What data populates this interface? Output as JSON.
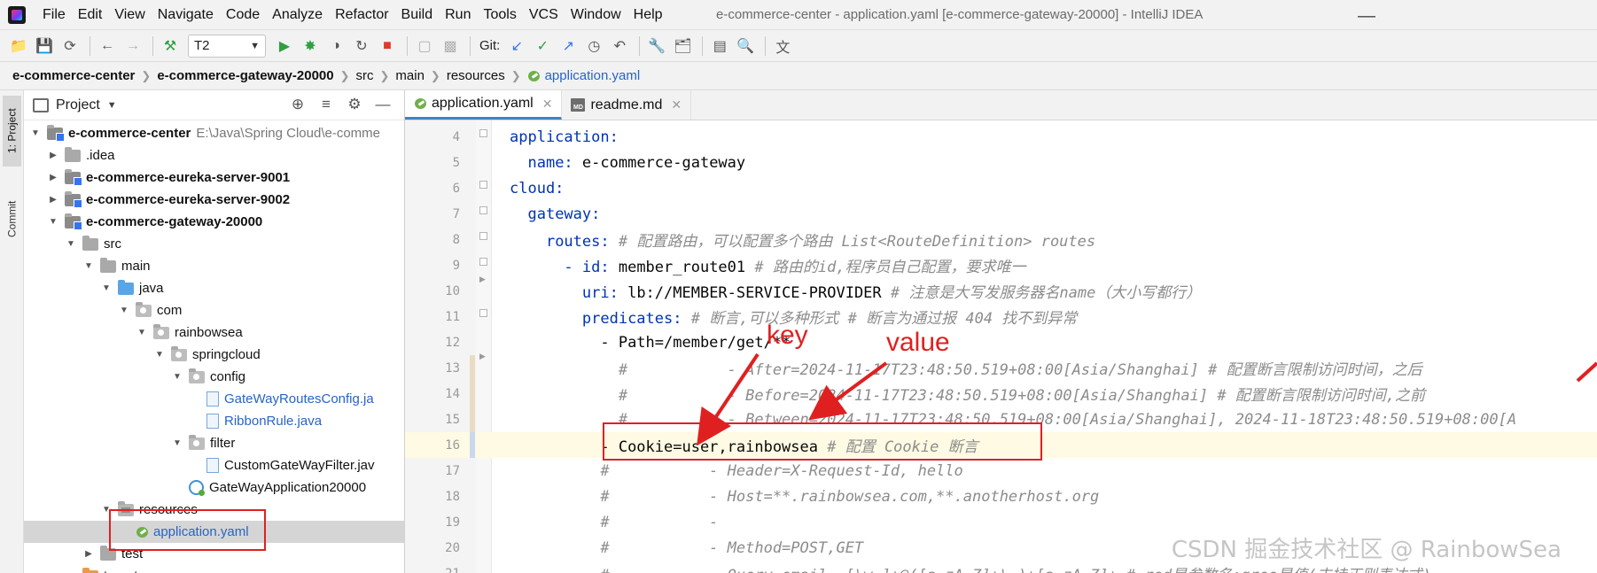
{
  "window": {
    "title": "e-commerce-center - application.yaml [e-commerce-gateway-20000] - IntelliJ IDEA",
    "minimize": "—"
  },
  "menu": [
    "File",
    "Edit",
    "View",
    "Navigate",
    "Code",
    "Analyze",
    "Refactor",
    "Build",
    "Run",
    "Tools",
    "VCS",
    "Window",
    "Help"
  ],
  "toolbar": {
    "run_config": "T2",
    "git_label": "Git:"
  },
  "breadcrumbs": [
    "e-commerce-center",
    "e-commerce-gateway-20000",
    "src",
    "main",
    "resources",
    "application.yaml"
  ],
  "left_stripe": {
    "project_tab": "1: Project",
    "commit_tab": "Commit"
  },
  "project_panel": {
    "title": "Project",
    "tree": [
      {
        "label": "e-commerce-center",
        "extra": "E:\\Java\\Spring Cloud\\e-comme",
        "depth": 0,
        "icon": "module",
        "expanded": true,
        "bold": true
      },
      {
        "label": ".idea",
        "depth": 1,
        "icon": "folder",
        "expanded": false
      },
      {
        "label": "e-commerce-eureka-server-9001",
        "depth": 1,
        "icon": "module",
        "expanded": false,
        "bold": true
      },
      {
        "label": "e-commerce-eureka-server-9002",
        "depth": 1,
        "icon": "module",
        "expanded": false,
        "bold": true
      },
      {
        "label": "e-commerce-gateway-20000",
        "depth": 1,
        "icon": "module",
        "expanded": true,
        "bold": true
      },
      {
        "label": "src",
        "depth": 2,
        "icon": "folder",
        "expanded": true
      },
      {
        "label": "main",
        "depth": 3,
        "icon": "folder",
        "expanded": true
      },
      {
        "label": "java",
        "depth": 4,
        "icon": "blue",
        "expanded": true
      },
      {
        "label": "com",
        "depth": 5,
        "icon": "pkg",
        "expanded": true
      },
      {
        "label": "rainbowsea",
        "depth": 6,
        "icon": "pkg",
        "expanded": true
      },
      {
        "label": "springcloud",
        "depth": 7,
        "icon": "pkg",
        "expanded": true
      },
      {
        "label": "config",
        "depth": 8,
        "icon": "pkg",
        "expanded": true
      },
      {
        "label": "GateWayRoutesConfig.ja",
        "depth": 9,
        "icon": "java",
        "leaf": true,
        "link": true
      },
      {
        "label": "RibbonRule.java",
        "depth": 9,
        "icon": "java",
        "leaf": true,
        "link": true
      },
      {
        "label": "filter",
        "depth": 8,
        "icon": "pkg",
        "expanded": true
      },
      {
        "label": "CustomGateWayFilter.jav",
        "depth": 9,
        "icon": "java",
        "leaf": true
      },
      {
        "label": "GateWayApplication20000",
        "depth": 8,
        "icon": "app",
        "leaf": true
      },
      {
        "label": "resources",
        "depth": 4,
        "icon": "res",
        "expanded": true
      },
      {
        "label": "application.yaml",
        "depth": 5,
        "icon": "yaml",
        "leaf": true,
        "link": true,
        "selected": true
      },
      {
        "label": "test",
        "depth": 3,
        "icon": "folder",
        "expanded": false
      },
      {
        "label": "target",
        "depth": 2,
        "icon": "orange",
        "expanded": true
      }
    ]
  },
  "editor_tabs": [
    {
      "label": "application.yaml",
      "active": true,
      "icon": "yaml"
    },
    {
      "label": "readme.md",
      "active": false,
      "icon": "md"
    }
  ],
  "editor": {
    "current_line": 16,
    "lines": [
      {
        "n": "4",
        "indent": "",
        "key": "application:",
        "val": "",
        "comment": ""
      },
      {
        "n": "5",
        "indent": "  ",
        "key": "name:",
        "val": " e-commerce-gateway",
        "comment": ""
      },
      {
        "n": "6",
        "indent": "",
        "key": "cloud:",
        "val": "",
        "comment": ""
      },
      {
        "n": "7",
        "indent": "  ",
        "key": "gateway:",
        "val": "",
        "comment": ""
      },
      {
        "n": "8",
        "indent": "    ",
        "key": "routes:",
        "val": "",
        "comment": " # 配置路由，可以配置多个路由 List<RouteDefinition> routes"
      },
      {
        "n": "9",
        "indent": "      ",
        "key": "- id:",
        "val": " member_route01",
        "comment": " # 路由的id,程序员自己配置，要求唯一"
      },
      {
        "n": "10",
        "indent": "        ",
        "key": "uri:",
        "val": " lb://MEMBER-SERVICE-PROVIDER",
        "comment": " # 注意是大写发服务器名name（大小写都行）"
      },
      {
        "n": "11",
        "indent": "        ",
        "key": "predicates:",
        "val": "",
        "comment": " # 断言,可以多种形式 # 断言为通过报 404 找不到异常"
      },
      {
        "n": "12",
        "indent": "          ",
        "key": "",
        "val": "- Path=/member/get/**",
        "comment": ""
      },
      {
        "n": "13",
        "indent": "            ",
        "key": "",
        "val": "",
        "comment": "#           - After=2024-11-17T23:48:50.519+08:00[Asia/Shanghai] # 配置断言限制访问时间，之后"
      },
      {
        "n": "14",
        "indent": "            ",
        "key": "",
        "val": "",
        "comment": "#           - Before=2024-11-17T23:48:50.519+08:00[Asia/Shanghai] # 配置断言限制访问时间,之前"
      },
      {
        "n": "15",
        "indent": "            ",
        "key": "",
        "val": "",
        "comment": "#           - Between=2024-11-17T23:48:50.519+08:00[Asia/Shanghai], 2024-11-18T23:48:50.519+08:00[A"
      },
      {
        "n": "16",
        "indent": "          ",
        "key": "",
        "val": "- Cookie=user,rainbowsea",
        "comment": " # 配置 Cookie 断言"
      },
      {
        "n": "17",
        "indent": "          ",
        "key": "",
        "val": "",
        "comment": "#           - Header=X-Request-Id, hello"
      },
      {
        "n": "18",
        "indent": "          ",
        "key": "",
        "val": "",
        "comment": "#           - Host=**.rainbowsea.com,**.anotherhost.org"
      },
      {
        "n": "19",
        "indent": "          ",
        "key": "",
        "val": "",
        "comment": "#           -"
      },
      {
        "n": "20",
        "indent": "          ",
        "key": "",
        "val": "",
        "comment": "#           - Method=POST,GET"
      },
      {
        "n": "21",
        "indent": "          ",
        "key": "",
        "val": "",
        "comment": "#           - Query=email, [\\w-]+@([a-zA-Z]+\\.)+[a-zA-Z]+ # red是参数名;gree是值(支持正则表达式)"
      }
    ]
  },
  "annotations": {
    "key_label": "key",
    "value_label": "value",
    "color": "#e02020"
  },
  "watermark": "CSDN 掘金技术社区 @ RainbowSea"
}
